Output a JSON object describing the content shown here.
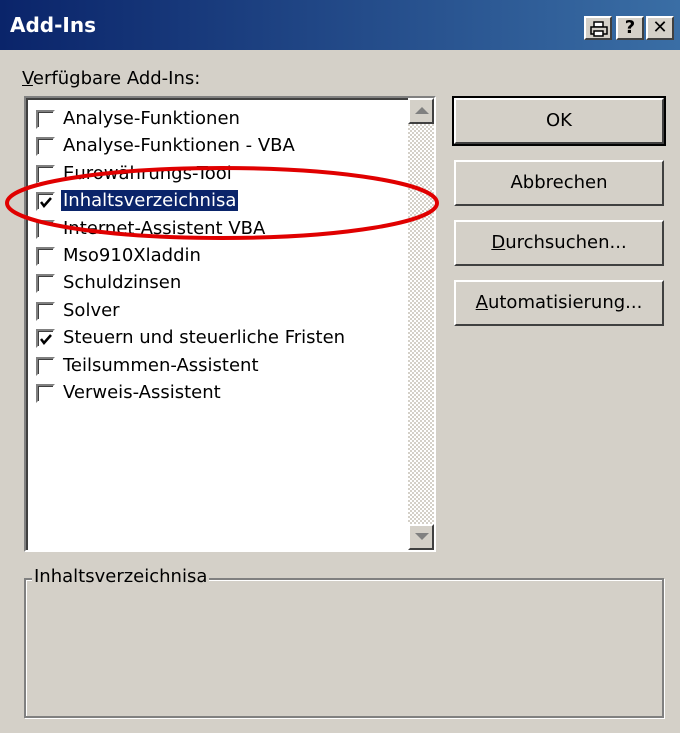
{
  "window": {
    "title": "Add-Ins",
    "help_label": "?",
    "close_label": "✕"
  },
  "available_label_prefix": "V",
  "available_label_rest": "erfügbare Add-Ins:",
  "addins": [
    {
      "label": "Analyse-Funktionen",
      "checked": false
    },
    {
      "label": "Analyse-Funktionen - VBA",
      "checked": false
    },
    {
      "label": "Eurowährungs-Tool",
      "checked": false
    },
    {
      "label": "Inhaltsverzeichnisa",
      "checked": true,
      "selected": true
    },
    {
      "label": "Internet-Assistent VBA",
      "checked": false
    },
    {
      "label": "Mso910Xladdin",
      "checked": false
    },
    {
      "label": "Schuldzinsen",
      "checked": false
    },
    {
      "label": "Solver",
      "checked": false
    },
    {
      "label": "Steuern und steuerliche Fristen",
      "checked": true
    },
    {
      "label": "Teilsummen-Assistent",
      "checked": false
    },
    {
      "label": "Verweis-Assistent",
      "checked": false
    }
  ],
  "buttons": {
    "ok": "OK",
    "cancel": "Abbrechen",
    "browse_u": "D",
    "browse_rest": "urchsuchen...",
    "automation_u": "A",
    "automation_rest": "utomatisierung..."
  },
  "description": {
    "title": "Inhaltsverzeichnisa"
  },
  "colors": {
    "titlebar": "#0a246a",
    "selection": "#0a246a",
    "face": "#d4d0c8",
    "annotation": "#e00000"
  }
}
